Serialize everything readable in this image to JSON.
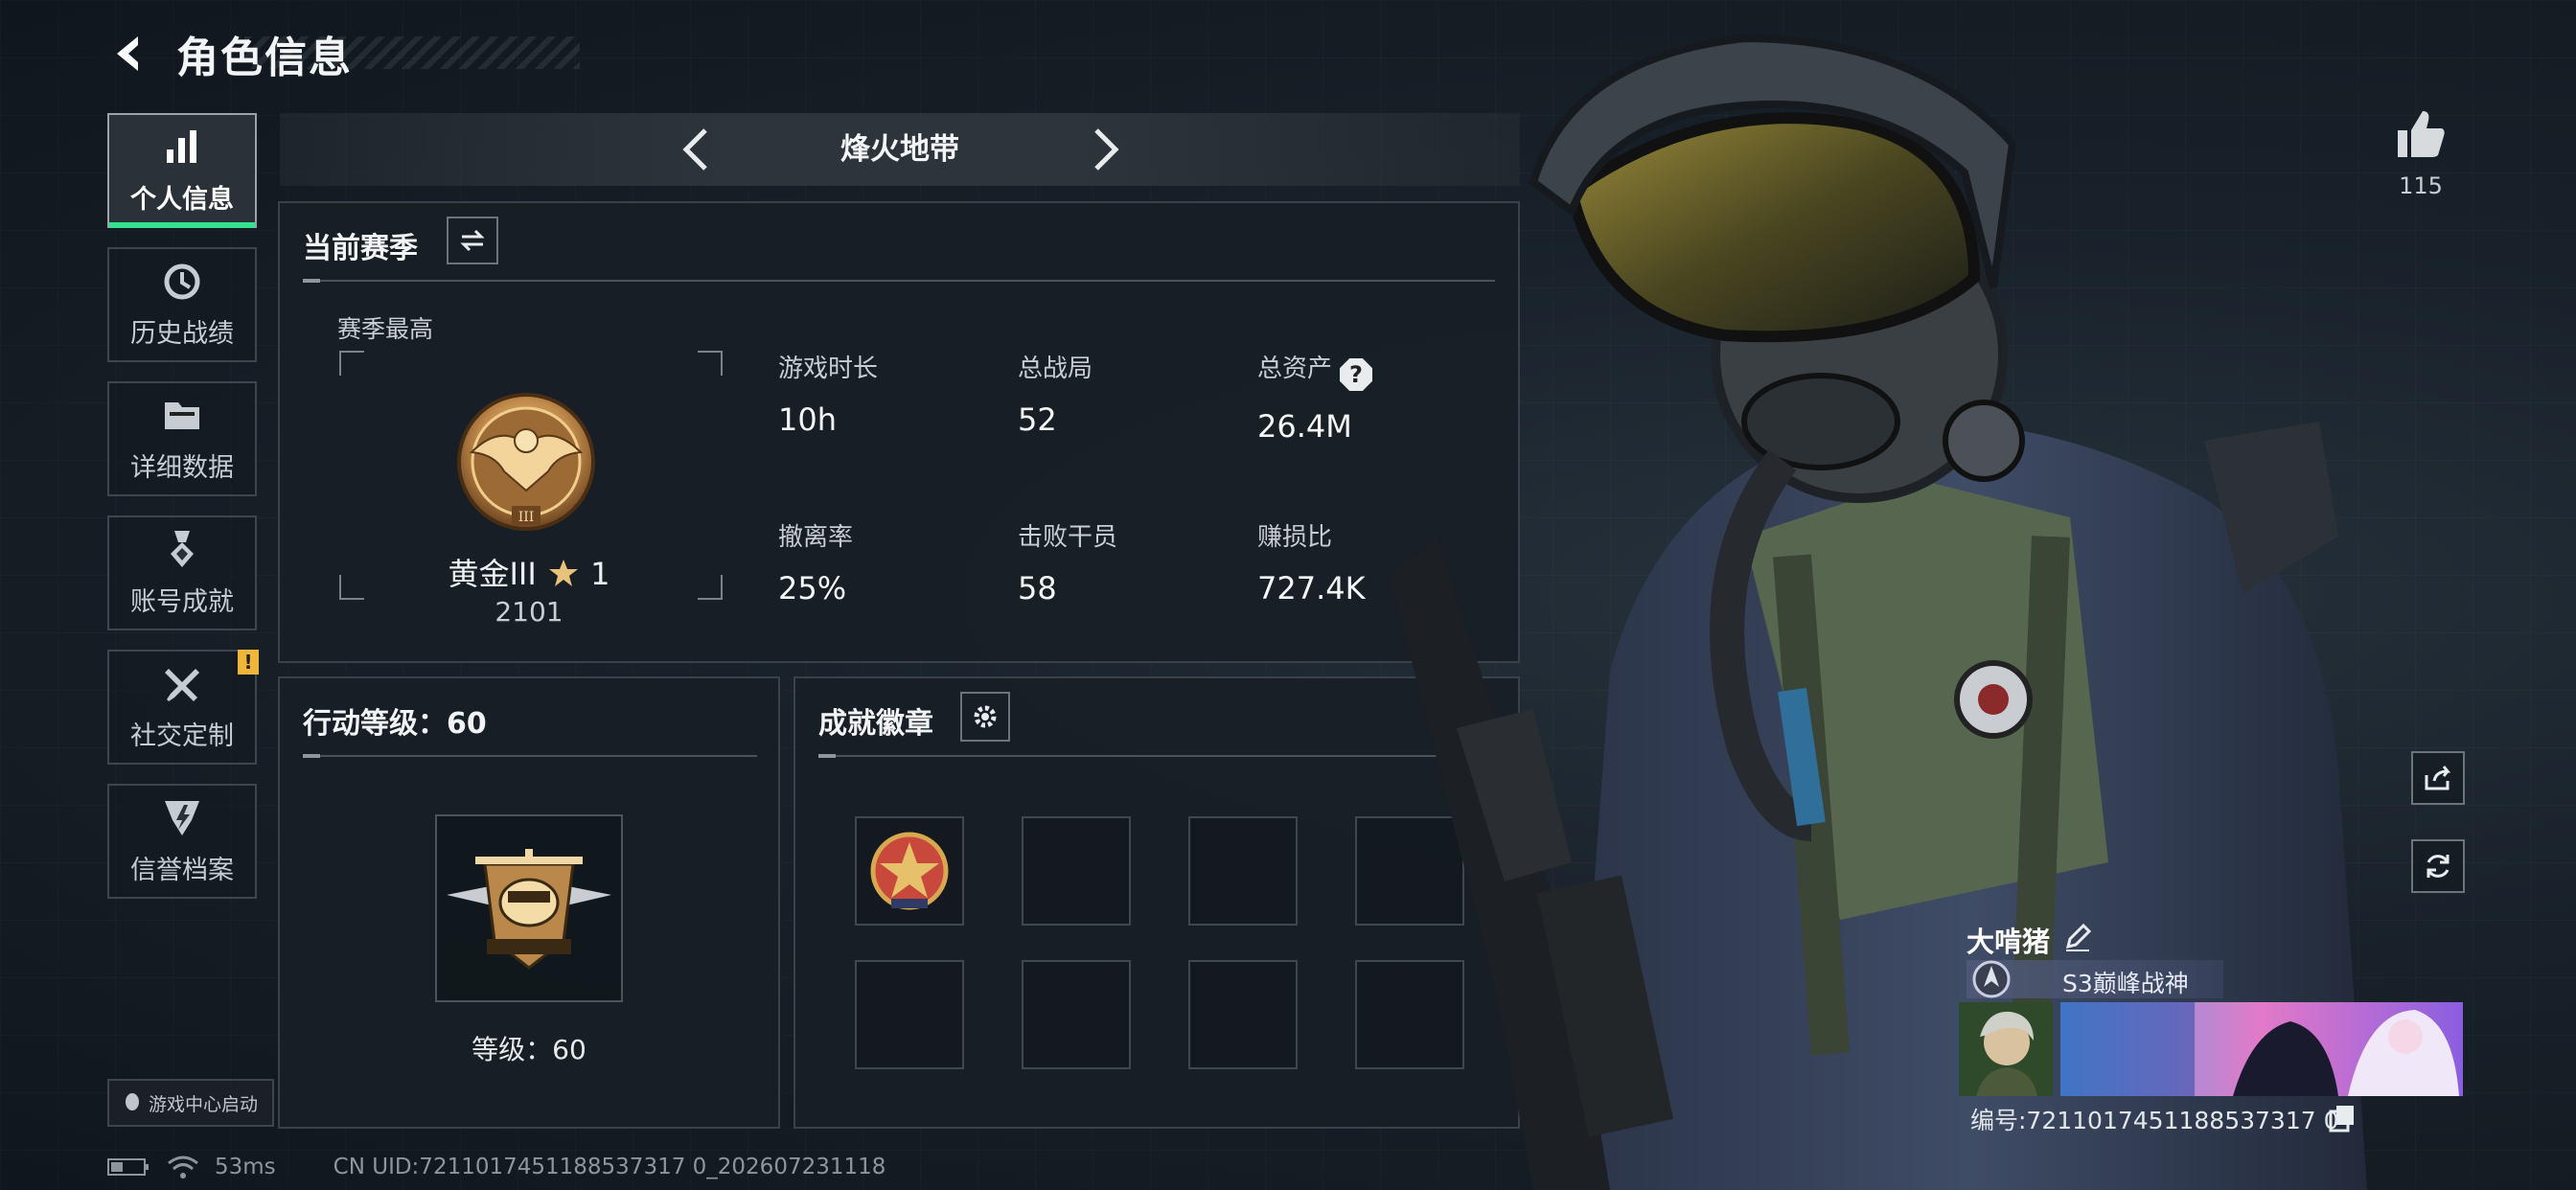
{
  "header": {
    "title": "角色信息"
  },
  "nav": {
    "items": [
      {
        "label": "个人信息",
        "icon": "bar-chart-icon",
        "active": true
      },
      {
        "label": "历史战绩",
        "icon": "history-clock-icon"
      },
      {
        "label": "详细数据",
        "icon": "folder-icon"
      },
      {
        "label": "账号成就",
        "icon": "medal-icon"
      },
      {
        "label": "社交定制",
        "icon": "tools-icon",
        "badge": "!"
      },
      {
        "label": "信誉档案",
        "icon": "credit-shield-icon"
      }
    ],
    "launch_label": "游戏中心启动"
  },
  "mode": {
    "name": "烽火地带"
  },
  "season": {
    "title": "当前赛季",
    "best_label": "赛季最高",
    "rank_prefix": "黄金III",
    "rank_stars": "1",
    "rank_score": "2101",
    "stats": [
      {
        "label": "游戏时长",
        "value": "10h"
      },
      {
        "label": "总战局",
        "value": "52"
      },
      {
        "label": "总资产",
        "value": "26.4M",
        "help": "?"
      },
      {
        "label": "撤离率",
        "value": "25%"
      },
      {
        "label": "击败干员",
        "value": "58"
      },
      {
        "label": "赚损比",
        "value": "727.4K"
      }
    ]
  },
  "level": {
    "title": "行动等级：60",
    "label": "等级：60"
  },
  "badges": {
    "title": "成就徽章",
    "slots": 8,
    "filled": 1
  },
  "like": {
    "count": "115"
  },
  "player": {
    "name": "大啃猪",
    "title": "S3巅峰战神",
    "uid_label": "编号:721101745118853731 70",
    "uid_text": "编号:7211017451188537317 0"
  },
  "status": {
    "ping": "53ms",
    "uid": "CN UID:7211017451188537317 0_202607231118"
  },
  "colors": {
    "accent": "#34e18e",
    "warning": "#f0b63b",
    "panel_border": "#39424a"
  }
}
